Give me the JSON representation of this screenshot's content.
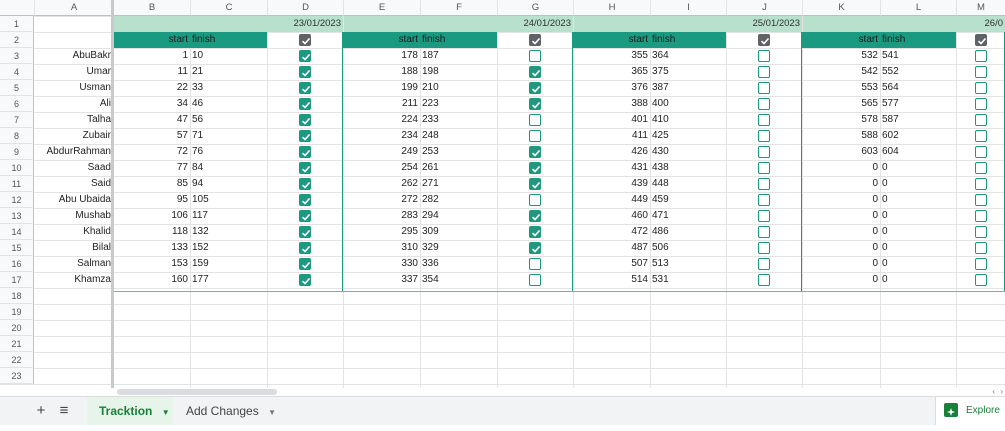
{
  "columns": [
    "A",
    "B",
    "C",
    "D",
    "E",
    "F",
    "G",
    "H",
    "I",
    "J",
    "K",
    "L",
    "M"
  ],
  "rows": [
    "1",
    "2",
    "3",
    "4",
    "5",
    "6",
    "7",
    "8",
    "9",
    "10",
    "11",
    "12",
    "13",
    "14",
    "15",
    "16",
    "17",
    "18",
    "19",
    "20",
    "21",
    "22",
    "23"
  ],
  "dates": [
    "23/01/2023",
    "24/01/2023",
    "25/01/2023",
    "26/0"
  ],
  "start_label": "start",
  "finish_label": "finish",
  "names": [
    "AbuBakr",
    "Umar",
    "Usman",
    "Ali",
    "Talha",
    "Zubair",
    "AbdurRahman",
    "Saad",
    "Said",
    "Abu Ubaida",
    "Mushab",
    "Khalid",
    "Bilal",
    "Salman",
    "Khamza"
  ],
  "day1": {
    "start": [
      "1",
      "11",
      "22",
      "34",
      "47",
      "57",
      "72",
      "77",
      "85",
      "95",
      "106",
      "118",
      "133",
      "153",
      "160"
    ],
    "finish": [
      "10",
      "21",
      "33",
      "46",
      "56",
      "71",
      "76",
      "84",
      "94",
      "105",
      "117",
      "132",
      "152",
      "159",
      "177"
    ],
    "done": [
      true,
      true,
      true,
      true,
      true,
      true,
      true,
      true,
      true,
      true,
      true,
      true,
      true,
      true,
      true
    ]
  },
  "day2": {
    "start": [
      "178",
      "188",
      "199",
      "211",
      "224",
      "234",
      "249",
      "254",
      "262",
      "272",
      "283",
      "295",
      "310",
      "330",
      "337"
    ],
    "finish": [
      "187",
      "198",
      "210",
      "223",
      "233",
      "248",
      "253",
      "261",
      "271",
      "282",
      "294",
      "309",
      "329",
      "336",
      "354"
    ],
    "done": [
      false,
      true,
      true,
      true,
      false,
      false,
      true,
      true,
      true,
      false,
      true,
      true,
      true,
      false,
      false
    ]
  },
  "day3": {
    "start": [
      "355",
      "365",
      "376",
      "388",
      "401",
      "411",
      "426",
      "431",
      "439",
      "449",
      "460",
      "472",
      "487",
      "507",
      "514"
    ],
    "finish": [
      "364",
      "375",
      "387",
      "400",
      "410",
      "425",
      "430",
      "438",
      "448",
      "459",
      "471",
      "486",
      "506",
      "513",
      "531"
    ],
    "done": [
      false,
      false,
      false,
      false,
      false,
      false,
      false,
      false,
      false,
      false,
      false,
      false,
      false,
      false,
      false
    ]
  },
  "day4": {
    "start": [
      "532",
      "542",
      "553",
      "565",
      "578",
      "588",
      "603",
      "0",
      "0",
      "0",
      "0",
      "0",
      "0",
      "0",
      "0"
    ],
    "finish": [
      "541",
      "552",
      "564",
      "577",
      "587",
      "602",
      "604",
      "0",
      "0",
      "0",
      "0",
      "0",
      "0",
      "0",
      "0"
    ],
    "done": [
      false,
      false,
      false,
      false,
      false,
      false,
      false,
      false,
      false,
      false,
      false,
      false,
      false,
      false,
      false
    ]
  },
  "tabs": {
    "active": "Tracktion",
    "inactive": "Add Changes"
  },
  "buttons": {
    "add": "+",
    "list": "≡",
    "explore": "Explore"
  },
  "colors": {
    "teal": "#1a9a80",
    "mint": "#b7e1cd",
    "checked": "#1a9a80",
    "active_tab": "#188038"
  }
}
